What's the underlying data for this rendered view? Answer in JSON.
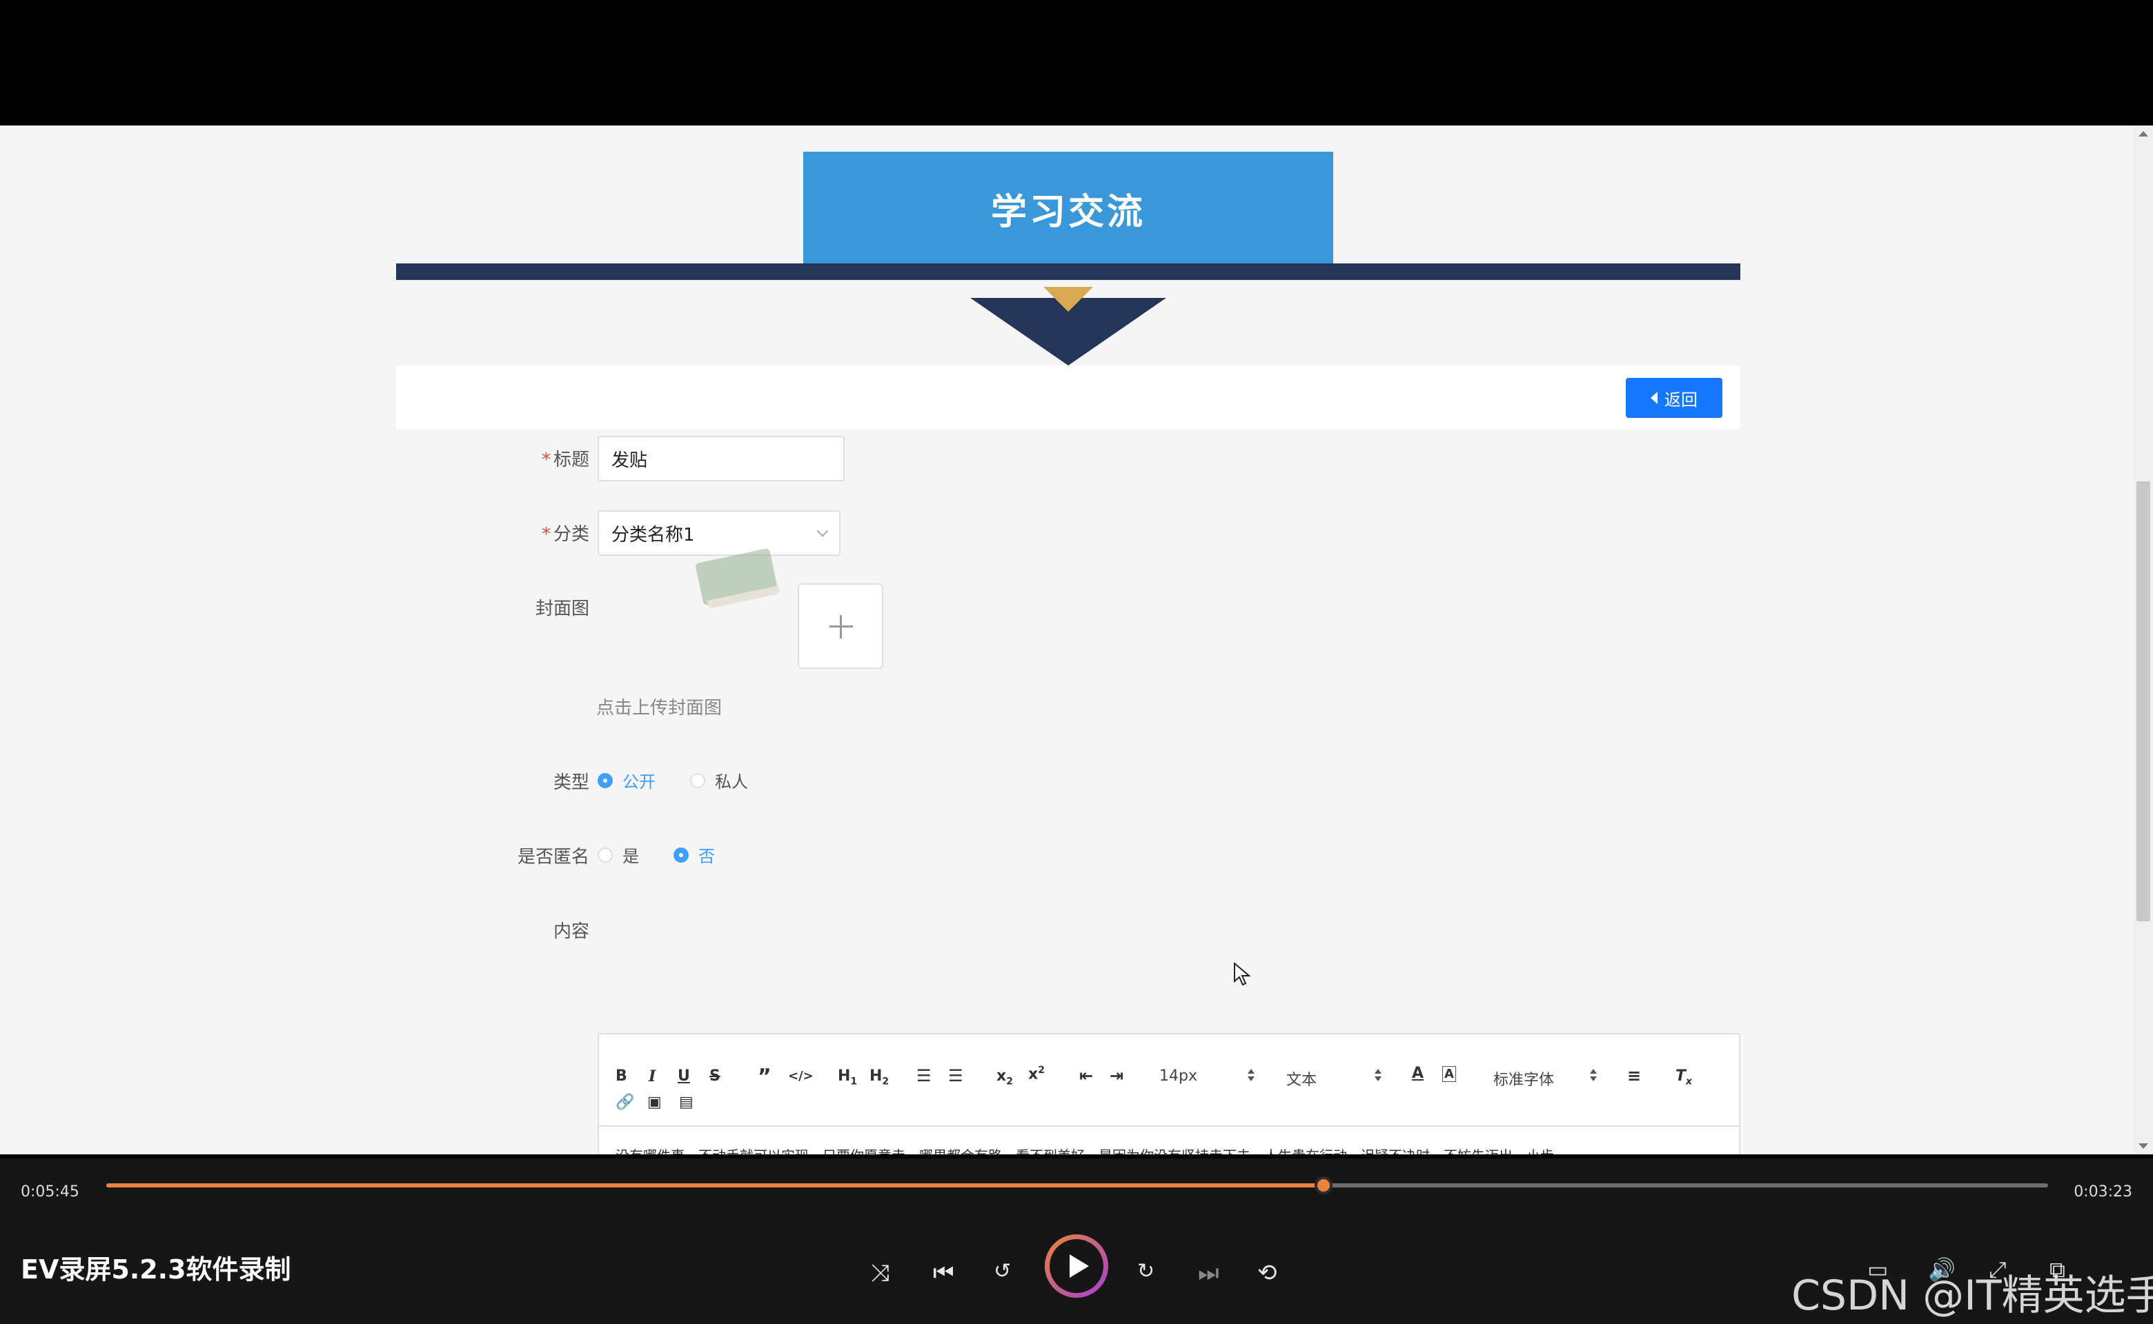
{
  "page": {
    "banner_title": "学习交流",
    "back_label": "返回"
  },
  "form": {
    "title_label": "标题",
    "title_value": "发贴",
    "category_label": "分类",
    "category_value": "分类名称1",
    "cover_label": "封面图",
    "cover_hint": "点击上传封面图",
    "type_label": "类型",
    "type_options": [
      "公开",
      "私人"
    ],
    "type_selected": "公开",
    "anon_label": "是否匿名",
    "anon_options": [
      "是",
      "否"
    ],
    "anon_selected": "否",
    "content_label": "内容"
  },
  "editor": {
    "font_size": "14px",
    "block_format": "文本",
    "font_family": "标准字体",
    "body_text": "没有哪件事，不动手就可以实现。只要你愿意走，哪里都会有路。看不到美好，是因为你没有坚持走下去，人生贵在行动，迟疑不决时，不妨先迈出一小步。"
  },
  "player": {
    "current_time": "0:05:45",
    "total_time": "0:03:23",
    "progress": 0.627,
    "title": "EV录屏5.2.3软件录制",
    "watermark": "CSDN @IT精英选手",
    "accent": "#e9853a"
  }
}
